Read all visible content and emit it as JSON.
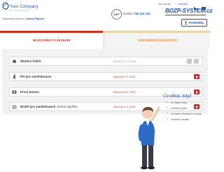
{
  "header": {
    "logo_name": "Your Company",
    "logo_tagline": "SLOGAN HERE",
    "responsible_label": "Odpovědný vedoucí:",
    "responsible_name": "Arnina Příjmení",
    "top_links": [
      "Jan Novák",
      "Odhlásit"
    ],
    "hotline_badge": "24/7",
    "hotline_label": "Hotline",
    "hotline_number": "732 112 112",
    "brand": "BOZP-SYSTEM.cz",
    "profile_button": "Prohlédky"
  },
  "tabs": [
    {
      "label": "MOJE KURZY A ŠKOLENÍ",
      "active": true
    },
    {
      "label": "DOKUMENTACE BOZP, PO",
      "active": false
    }
  ],
  "courses": [
    {
      "title": "Školení řidičů",
      "subtitle": "",
      "date": "Splněno 27. 8. 2018",
      "status": "done",
      "icon": "car-icon"
    },
    {
      "title": "PO pro zaměstnance",
      "subtitle": "",
      "date": "Splnit do 6. 9. 2018",
      "status": "due",
      "icon": "fire-extinguisher-icon"
    },
    {
      "title": "První pomoc",
      "subtitle": "",
      "date": "Splnit do 6. 9. 2018",
      "status": "due",
      "icon": "first-aid-icon"
    },
    {
      "title": "BOZP pro zaměstnance",
      "subtitle": "včetně doplňku",
      "date": "Splnit do 6. 9. 2018",
      "status": "due",
      "icon": "safety-icon"
    }
  ],
  "faq": {
    "title": "Co dělat, když",
    "items": [
      "se stane úraz",
      "vznikne požár",
      "se stane dopravní nehoda",
      "vznikne závada"
    ]
  },
  "colors": {
    "brand_blue": "#1b56b0",
    "accent_red": "#d03020",
    "inactive_tab": "#e08a30"
  }
}
